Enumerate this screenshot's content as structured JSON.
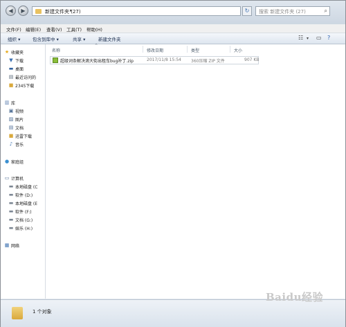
{
  "address": {
    "crumb": "新建文件夹 (27)",
    "arrow": "▸"
  },
  "search": {
    "placeholder": "搜索 新建文件夹 (27)"
  },
  "menu": [
    "文件(F)",
    "编辑(E)",
    "查看(V)",
    "工具(T)",
    "帮助(H)"
  ],
  "toolbar": {
    "organize": "组织 ▾",
    "include": "包含到库中 ▾",
    "share": "共享 ▾",
    "new_folder": "新建文件夹"
  },
  "nav": {
    "favorites": {
      "label": "收藏夹",
      "items": [
        "下载",
        "桌面",
        "最近访问的",
        "2345下载"
      ]
    },
    "libraries": {
      "label": "库",
      "items": [
        "视频",
        "图片",
        "文档",
        "迅雷下载",
        "音乐"
      ]
    },
    "homegroup": {
      "label": "家庭组"
    },
    "computer": {
      "label": "计算机",
      "items": [
        "本地磁盘 (C",
        "软件 (D:)",
        "本地磁盘 (E",
        "软件 (F:)",
        "文档 (G:)",
        "娱乐 (H:)"
      ]
    },
    "network": {
      "label": "网络"
    }
  },
  "columns": {
    "name": "名称",
    "date": "修改日期",
    "type": "类型",
    "size": "大小"
  },
  "file": {
    "name": "超级词条解决滴大街出租车bug补丁.zip",
    "date": "2017/11/8 15:54",
    "type": "360压缩 ZIP 文件",
    "size": "907 KB"
  },
  "status": {
    "count": "1 个对象"
  },
  "watermark": "Baidu经验",
  "colors": {
    "accent": "#3a6fb0",
    "folder": "#e8c160",
    "zip": "#8bbd3a"
  }
}
